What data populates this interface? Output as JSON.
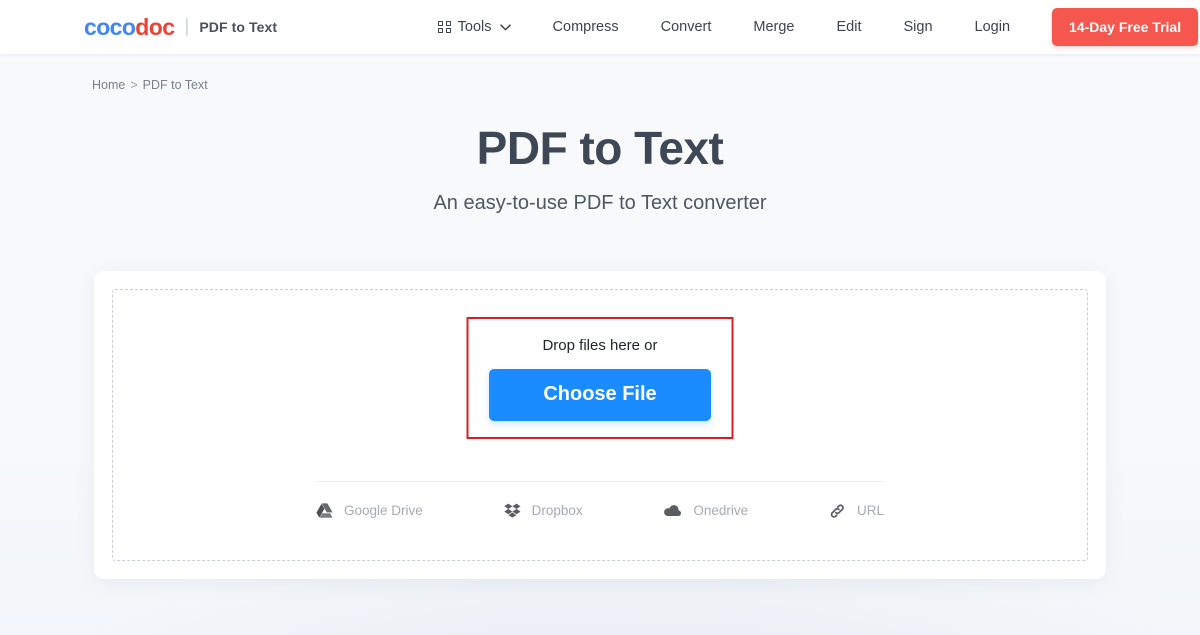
{
  "header": {
    "logo": {
      "part1": "coco",
      "part2": "doc",
      "separator": "|"
    },
    "product_name": "PDF to Text",
    "nav": [
      {
        "label": "Tools",
        "icon": "grid-icon",
        "has_dropdown": true,
        "chevron": "⌄"
      },
      {
        "label": "Compress",
        "icon": null,
        "has_dropdown": false
      },
      {
        "label": "Convert",
        "icon": null,
        "has_dropdown": false
      },
      {
        "label": "Merge",
        "icon": null,
        "has_dropdown": false
      },
      {
        "label": "Edit",
        "icon": null,
        "has_dropdown": false
      },
      {
        "label": "Sign",
        "icon": null,
        "has_dropdown": false
      },
      {
        "label": "Login",
        "icon": null,
        "has_dropdown": false
      }
    ],
    "cta_label": "14-Day Free Trial",
    "cta_color": "#f5564e"
  },
  "breadcrumb": {
    "home": "Home",
    "separator": ">",
    "current": "PDF to Text"
  },
  "hero": {
    "title": "PDF to Text",
    "subtitle": "An easy-to-use PDF to Text converter"
  },
  "upload": {
    "drop_text": "Drop files here or",
    "choose_label": "Choose File",
    "choose_color": "#1a8cff",
    "highlight_color": "#d81f26",
    "services": [
      {
        "label": "Google Drive",
        "icon": "google-drive-icon"
      },
      {
        "label": "Dropbox",
        "icon": "dropbox-icon"
      },
      {
        "label": "Onedrive",
        "icon": "onedrive-icon"
      },
      {
        "label": "URL",
        "icon": "link-icon"
      }
    ]
  }
}
